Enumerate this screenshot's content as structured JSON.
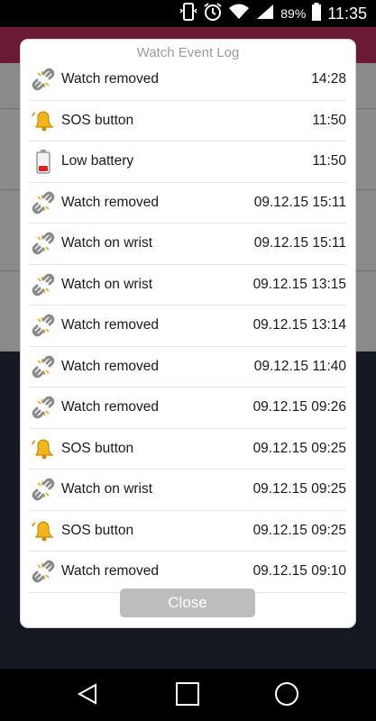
{
  "status_bar": {
    "battery_percent": "89%",
    "time": "11:35"
  },
  "dialog": {
    "title": "Watch Event Log",
    "close_label": "Close",
    "events": [
      {
        "icon": "chain-broken-icon",
        "label": "Watch removed",
        "time": "14:28"
      },
      {
        "icon": "bell-icon",
        "label": "SOS button",
        "time": "11:50"
      },
      {
        "icon": "low-battery-icon",
        "label": "Low battery",
        "time": "11:50"
      },
      {
        "icon": "chain-broken-icon",
        "label": "Watch removed",
        "time": "09.12.15 15:11"
      },
      {
        "icon": "chain-broken-icon",
        "label": "Watch on wrist",
        "time": "09.12.15 15:11"
      },
      {
        "icon": "chain-broken-icon",
        "label": "Watch on wrist",
        "time": "09.12.15 13:15"
      },
      {
        "icon": "chain-broken-icon",
        "label": "Watch removed",
        "time": "09.12.15 13:14"
      },
      {
        "icon": "chain-broken-icon",
        "label": "Watch removed",
        "time": "09.12.15 11:40"
      },
      {
        "icon": "chain-broken-icon",
        "label": "Watch removed",
        "time": "09.12.15 09:26"
      },
      {
        "icon": "bell-icon",
        "label": "SOS button",
        "time": "09.12.15 09:25"
      },
      {
        "icon": "chain-broken-icon",
        "label": "Watch on wrist",
        "time": "09.12.15 09:25"
      },
      {
        "icon": "bell-icon",
        "label": "SOS button",
        "time": "09.12.15 09:25"
      },
      {
        "icon": "chain-broken-icon",
        "label": "Watch removed",
        "time": "09.12.15 09:10"
      }
    ]
  }
}
